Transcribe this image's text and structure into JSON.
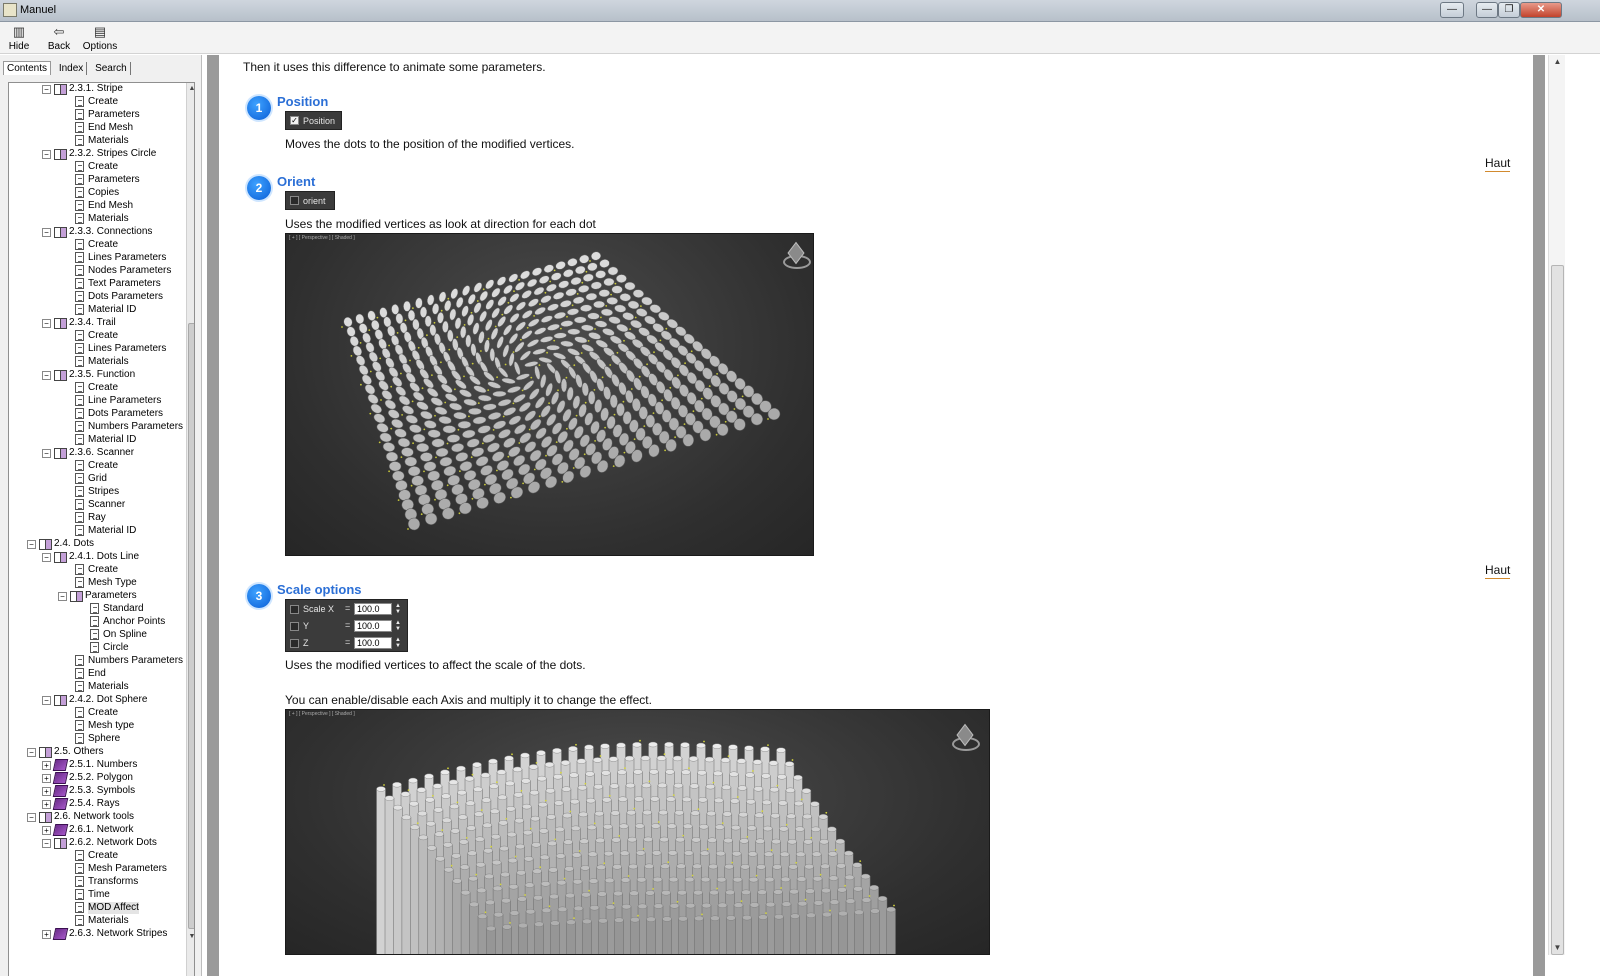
{
  "window": {
    "title": "Manuel",
    "minimize_glyph": "—",
    "restore_glyph": "❐",
    "close_glyph": "✕"
  },
  "toolbar": {
    "buttons": [
      {
        "label": "Hide",
        "icon": "hide-panel-icon"
      },
      {
        "label": "Back",
        "icon": "back-arrow-icon"
      },
      {
        "label": "Options",
        "icon": "options-icon"
      }
    ]
  },
  "nav_tabs": [
    "Contents",
    "Index",
    "Search"
  ],
  "tree": [
    {
      "level": 2,
      "kind": "open",
      "exp": "−",
      "label": "2.3.1. Stripe"
    },
    {
      "level": 3,
      "kind": "page",
      "label": "Create"
    },
    {
      "level": 3,
      "kind": "page",
      "label": "Parameters"
    },
    {
      "level": 3,
      "kind": "page",
      "label": "End Mesh"
    },
    {
      "level": 3,
      "kind": "page",
      "label": "Materials"
    },
    {
      "level": 2,
      "kind": "open",
      "exp": "−",
      "label": "2.3.2. Stripes Circle"
    },
    {
      "level": 3,
      "kind": "page",
      "label": "Create"
    },
    {
      "level": 3,
      "kind": "page",
      "label": "Parameters"
    },
    {
      "level": 3,
      "kind": "page",
      "label": "Copies"
    },
    {
      "level": 3,
      "kind": "page",
      "label": "End Mesh"
    },
    {
      "level": 3,
      "kind": "page",
      "label": "Materials"
    },
    {
      "level": 2,
      "kind": "open",
      "exp": "−",
      "label": "2.3.3. Connections"
    },
    {
      "level": 3,
      "kind": "page",
      "label": "Create"
    },
    {
      "level": 3,
      "kind": "page",
      "label": "Lines Parameters"
    },
    {
      "level": 3,
      "kind": "page",
      "label": "Nodes Parameters"
    },
    {
      "level": 3,
      "kind": "page",
      "label": "Text Parameters"
    },
    {
      "level": 3,
      "kind": "page",
      "label": "Dots Parameters"
    },
    {
      "level": 3,
      "kind": "page",
      "label": "Material ID"
    },
    {
      "level": 2,
      "kind": "open",
      "exp": "−",
      "label": "2.3.4. Trail"
    },
    {
      "level": 3,
      "kind": "page",
      "label": "Create"
    },
    {
      "level": 3,
      "kind": "page",
      "label": "Lines Parameters"
    },
    {
      "level": 3,
      "kind": "page",
      "label": "Materials"
    },
    {
      "level": 2,
      "kind": "open",
      "exp": "−",
      "label": "2.3.5. Function"
    },
    {
      "level": 3,
      "kind": "page",
      "label": "Create"
    },
    {
      "level": 3,
      "kind": "page",
      "label": "Line Parameters"
    },
    {
      "level": 3,
      "kind": "page",
      "label": "Dots Parameters"
    },
    {
      "level": 3,
      "kind": "page",
      "label": "Numbers Parameters"
    },
    {
      "level": 3,
      "kind": "page",
      "label": "Material ID"
    },
    {
      "level": 2,
      "kind": "open",
      "exp": "−",
      "label": "2.3.6. Scanner"
    },
    {
      "level": 3,
      "kind": "page",
      "label": "Create"
    },
    {
      "level": 3,
      "kind": "page",
      "label": "Grid"
    },
    {
      "level": 3,
      "kind": "page",
      "label": "Stripes"
    },
    {
      "level": 3,
      "kind": "page",
      "label": "Scanner"
    },
    {
      "level": 3,
      "kind": "page",
      "label": "Ray"
    },
    {
      "level": 3,
      "kind": "page",
      "label": "Material ID"
    },
    {
      "level": 1,
      "kind": "open",
      "exp": "−",
      "label": "2.4. Dots"
    },
    {
      "level": 2,
      "kind": "open",
      "exp": "−",
      "label": "2.4.1. Dots Line"
    },
    {
      "level": 3,
      "kind": "page",
      "label": "Create"
    },
    {
      "level": 3,
      "kind": "page",
      "label": "Mesh Type"
    },
    {
      "level": 3,
      "kind": "open",
      "exp": "−",
      "label": "Parameters"
    },
    {
      "level": 4,
      "kind": "page",
      "label": "Standard"
    },
    {
      "level": 4,
      "kind": "page",
      "label": "Anchor Points"
    },
    {
      "level": 4,
      "kind": "page",
      "label": "On Spline"
    },
    {
      "level": 4,
      "kind": "page",
      "label": "Circle"
    },
    {
      "level": 3,
      "kind": "page",
      "label": "Numbers Parameters"
    },
    {
      "level": 3,
      "kind": "page",
      "label": "End"
    },
    {
      "level": 3,
      "kind": "page",
      "label": "Materials"
    },
    {
      "level": 2,
      "kind": "open",
      "exp": "−",
      "label": "2.4.2. Dot Sphere"
    },
    {
      "level": 3,
      "kind": "page",
      "label": "Create"
    },
    {
      "level": 3,
      "kind": "page",
      "label": "Mesh type"
    },
    {
      "level": 3,
      "kind": "page",
      "label": "Sphere"
    },
    {
      "level": 1,
      "kind": "open",
      "exp": "−",
      "label": "2.5. Others"
    },
    {
      "level": 2,
      "kind": "closed",
      "exp": "+",
      "label": "2.5.1. Numbers"
    },
    {
      "level": 2,
      "kind": "closed",
      "exp": "+",
      "label": "2.5.2. Polygon"
    },
    {
      "level": 2,
      "kind": "closed",
      "exp": "+",
      "label": "2.5.3. Symbols"
    },
    {
      "level": 2,
      "kind": "closed",
      "exp": "+",
      "label": "2.5.4. Rays"
    },
    {
      "level": 1,
      "kind": "open",
      "exp": "−",
      "label": "2.6. Network tools"
    },
    {
      "level": 2,
      "kind": "closed",
      "exp": "+",
      "label": "2.6.1. Network"
    },
    {
      "level": 2,
      "kind": "open",
      "exp": "−",
      "label": "2.6.2. Network Dots"
    },
    {
      "level": 3,
      "kind": "page",
      "label": "Create"
    },
    {
      "level": 3,
      "kind": "page",
      "label": "Mesh Parameters"
    },
    {
      "level": 3,
      "kind": "page",
      "label": "Transforms"
    },
    {
      "level": 3,
      "kind": "page",
      "label": "Time"
    },
    {
      "level": 3,
      "kind": "page",
      "label": "MOD Affect",
      "selected": true
    },
    {
      "level": 3,
      "kind": "page",
      "label": "Materials"
    },
    {
      "level": 2,
      "kind": "closed",
      "exp": "+",
      "label": "2.6.3. Network Stripes"
    }
  ],
  "content": {
    "intro": "Then it uses this difference to animate some parameters.",
    "back_to_top": "Haut",
    "sections": [
      {
        "number": "1",
        "title": "Position",
        "checkbox_label": "Position",
        "checked": true,
        "description": "Moves the dots to the position of the modified vertices."
      },
      {
        "number": "2",
        "title": "Orient",
        "checkbox_label": "orient",
        "checked": false,
        "description": "Uses the modified vertices as look at direction for each dot"
      },
      {
        "number": "3",
        "title": "Scale  options",
        "scale_rows": [
          {
            "label": "Scale X",
            "value": "100.0"
          },
          {
            "label": "Y",
            "value": "100.0"
          },
          {
            "label": "Z",
            "value": "100.0"
          }
        ],
        "description": "Uses the modified vertices to affect the scale of the dots.",
        "description2": "You can enable/disable each Axis and multiply it to change the effect."
      }
    ],
    "viewport_label": "[ + ] [ Perspective ] [ Shaded ]"
  },
  "colors": {
    "heading": "#2b6fd6",
    "badge": "#0a5ed6",
    "haut_underline": "#d28a2e",
    "viewport_bg": "#303030"
  }
}
